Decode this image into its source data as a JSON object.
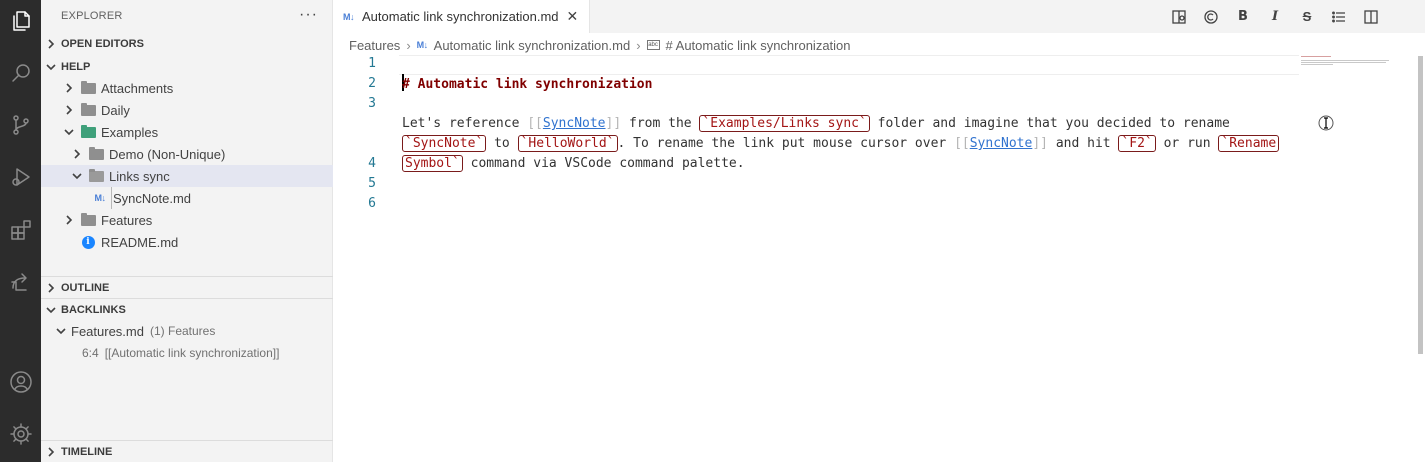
{
  "sidebar": {
    "title": "EXPLORER",
    "more": "···",
    "sections": {
      "open_editors": "OPEN EDITORS",
      "help": "HELP",
      "outline": "OUTLINE",
      "backlinks": "BACKLINKS",
      "timeline": "TIMELINE"
    },
    "tree": [
      {
        "label": "Attachments"
      },
      {
        "label": "Daily"
      },
      {
        "label": "Examples"
      },
      {
        "label": "Demo (Non-Unique)"
      },
      {
        "label": "Links sync"
      },
      {
        "label": "SyncNote.md"
      },
      {
        "label": "Features"
      },
      {
        "label": "README.md"
      }
    ],
    "backlinks": {
      "file": "Features.md",
      "count": "(1) Features",
      "position": "6:4",
      "snippet": "[[Automatic link synchronization]]"
    }
  },
  "editor": {
    "tab": {
      "icon": "M↓",
      "label": "Automatic link synchronization.md",
      "close": "✕"
    },
    "breadcrumb": {
      "folder": "Features",
      "file": "Automatic link synchronization.md",
      "symbol": "# Automatic link synchronization"
    },
    "line_numbers": [
      "1",
      "2",
      "3",
      "4",
      "5",
      "6"
    ],
    "heading": "# Automatic link synchronization",
    "line3a": {
      "t1": "Let's reference ",
      "wl_open": "[[",
      "wl_text": "SyncNote",
      "wl_close": "]]",
      "t2": " from the ",
      "code1": "`Examples/Links sync`",
      "t3": " folder and imagine that you decided to rename"
    },
    "line3b": {
      "code2": "`SyncNote`",
      "t4": " to ",
      "code3": "`HelloWorld`",
      "t5": ". To rename the link put mouse cursor over ",
      "wl_open": "[[",
      "wl_text": "SyncNote",
      "wl_close": "]]",
      "t6": " and hit ",
      "code4": "`F2`",
      "t7": " or run ",
      "code5": "`Rename"
    },
    "line3c": {
      "code6": "Symbol`",
      "t8": " command via VSCode command palette."
    }
  },
  "toolbar": {
    "bold": "B",
    "italic": "I",
    "strike": "S"
  },
  "icons": [
    "files-icon",
    "search-icon",
    "source-control-icon",
    "run-debug-icon",
    "extensions-icon",
    "remote-icon",
    "account-icon",
    "gear-icon"
  ],
  "colors": {
    "activity_bar": "#2c2c2c",
    "sidebar": "#f3f3f3",
    "heading": "#800000",
    "inline_code": "#a31515",
    "wikilink": "#3173cf",
    "line_numbers": "#237893",
    "selected_row": "#e4e6f1"
  }
}
